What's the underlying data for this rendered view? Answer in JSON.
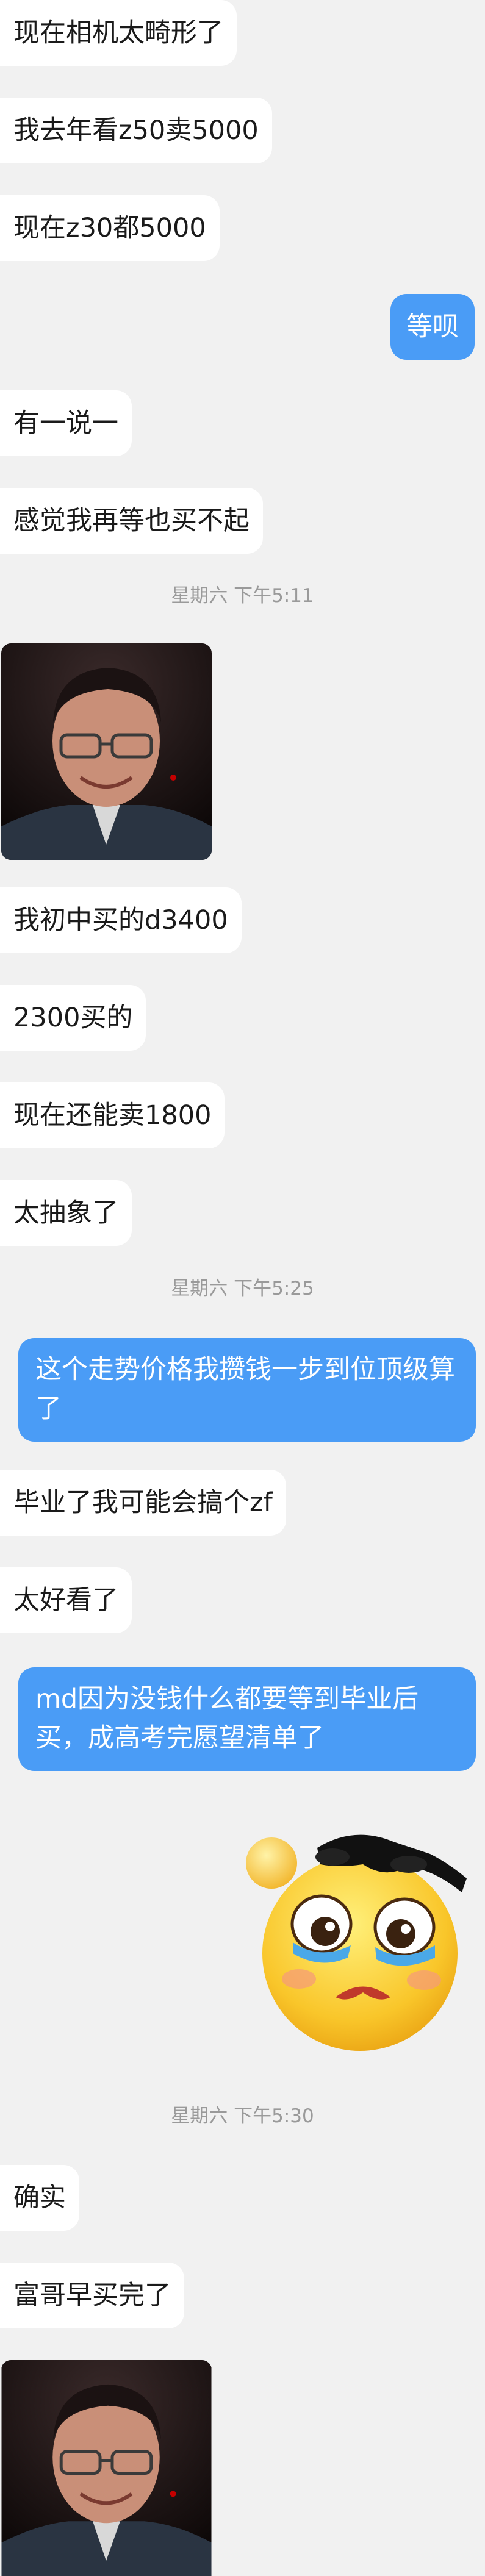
{
  "messages": [
    {
      "side": "in",
      "text": "现在相机太畸形了"
    },
    {
      "side": "in",
      "text": "我去年看z50卖5000"
    },
    {
      "side": "in",
      "text": "现在z30都5000"
    },
    {
      "side": "out",
      "text": "等呗"
    },
    {
      "side": "in",
      "text": "有一说一"
    },
    {
      "side": "in",
      "text": "感觉我再等也买不起"
    },
    {
      "side": "ts",
      "text": "星期六 下午5:11"
    },
    {
      "side": "in-image",
      "icon": "man-smiling-photo"
    },
    {
      "side": "in",
      "text": "我初中买的d3400"
    },
    {
      "side": "in",
      "text": "2300买的"
    },
    {
      "side": "in",
      "text": "现在还能卖1800"
    },
    {
      "side": "in",
      "text": "太抽象了"
    },
    {
      "side": "ts",
      "text": "星期六 下午5:25"
    },
    {
      "side": "out",
      "text": "这个走势价格我攒钱一步到位顶级算了"
    },
    {
      "side": "in",
      "text": "毕业了我可能会搞个zf"
    },
    {
      "side": "in",
      "text": "太好看了"
    },
    {
      "side": "out",
      "text": "md因为没钱什么都要等到毕业后买，成高考完愿望清单了"
    },
    {
      "side": "out-sticker",
      "icon": "crying-emoji-sunglasses-sticker"
    },
    {
      "side": "ts",
      "text": "星期六 下午5:30"
    },
    {
      "side": "in",
      "text": "确实"
    },
    {
      "side": "in",
      "text": "富哥早买完了"
    },
    {
      "side": "in-image",
      "icon": "man-smiling-photo"
    }
  ],
  "colors": {
    "background": "#f1f1f1",
    "incoming_bubble": "#ffffff",
    "outgoing_bubble": "#4a9cf6",
    "timestamp": "#9a9a9a"
  }
}
